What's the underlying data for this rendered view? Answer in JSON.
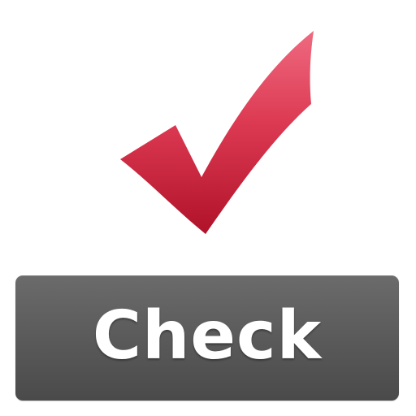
{
  "icon": {
    "name": "checkmark-icon",
    "color_top": "#e9546b",
    "color_bottom": "#b4142b"
  },
  "button": {
    "label": "Check",
    "background": "#5c5c5c",
    "text_color": "#ffffff"
  }
}
